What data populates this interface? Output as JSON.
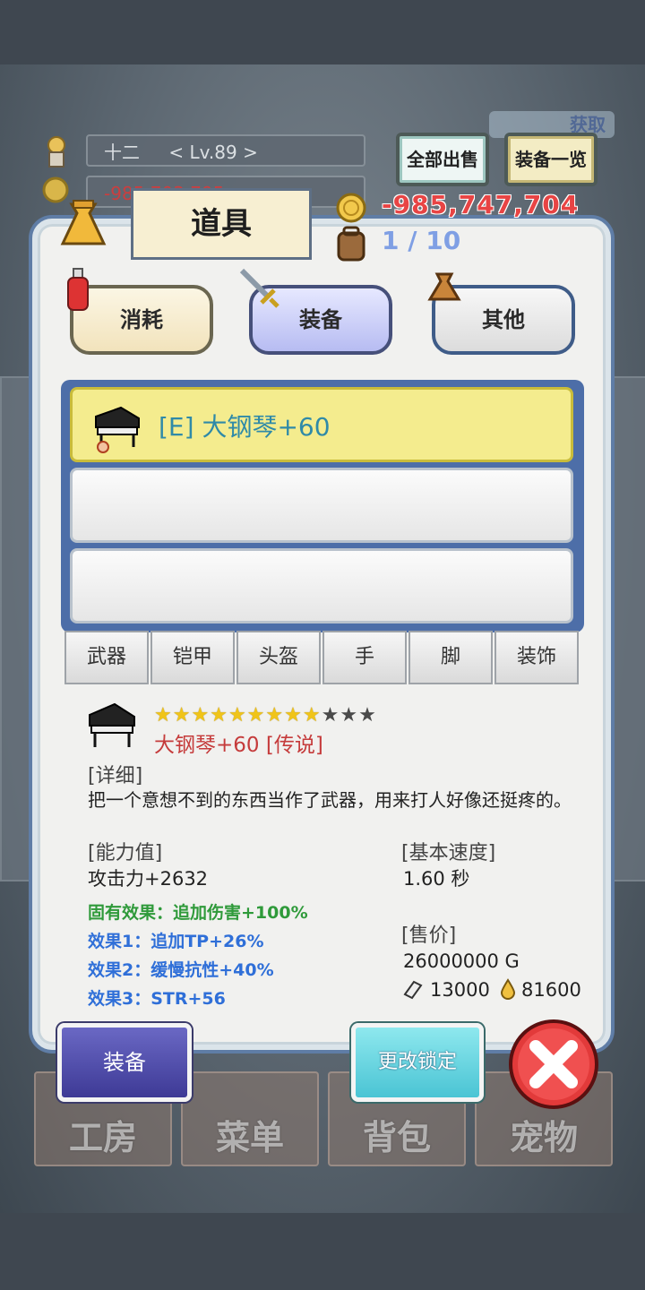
{
  "player": {
    "name": "十二",
    "level": "< Lv.89 >",
    "money_partial": "-985,703,795"
  },
  "top_buttons": {
    "sell_all": "全部出售",
    "equip_list": "装备一览",
    "faded_label": "获取"
  },
  "stats": {
    "gold": "-985,747,704",
    "bag": "1 / 10"
  },
  "panel": {
    "title": "道具"
  },
  "categories": [
    {
      "label": "消耗"
    },
    {
      "label": "装备"
    },
    {
      "label": "其他"
    }
  ],
  "item_list": [
    {
      "label": "[E] 大钢琴+60",
      "selected": true
    },
    {
      "label": ""
    },
    {
      "label": ""
    }
  ],
  "filter_tabs": [
    {
      "label": "武器"
    },
    {
      "label": "铠甲"
    },
    {
      "label": "头盔"
    },
    {
      "label": "手"
    },
    {
      "label": "脚"
    },
    {
      "label": "装饰"
    }
  ],
  "detail": {
    "stars_filled": 9,
    "stars_total": 12,
    "name": "大钢琴+60 [传说]",
    "detail_header": "[详细]",
    "description": "把一个意想不到的东西当作了武器，用来打人好像还挺疼的。",
    "ability_header": "[能力值]",
    "attack": "攻击力+2632",
    "fixed_effect": "固有效果：追加伤害+100%",
    "effect1": "效果1：追加TP+26%",
    "effect2": "效果2：缓慢抗性+40%",
    "effect3": "效果3：STR+56",
    "speed_header": "[基本速度]",
    "speed": "1.60 秒",
    "price_header": "[售价]",
    "price": "26000000 G",
    "material1": "13000",
    "material2": "81600"
  },
  "actions": {
    "equip": "装备",
    "change_lock": "更改锁定"
  },
  "bottom_nav": [
    {
      "label": "工房"
    },
    {
      "label": "菜单"
    },
    {
      "label": "背包"
    },
    {
      "label": "宠物"
    }
  ],
  "colors": {
    "gold_text": "#e84444",
    "effect_green": "#2f9a3a",
    "effect_blue": "#2f6fd8",
    "item_red": "#c53b3b"
  }
}
